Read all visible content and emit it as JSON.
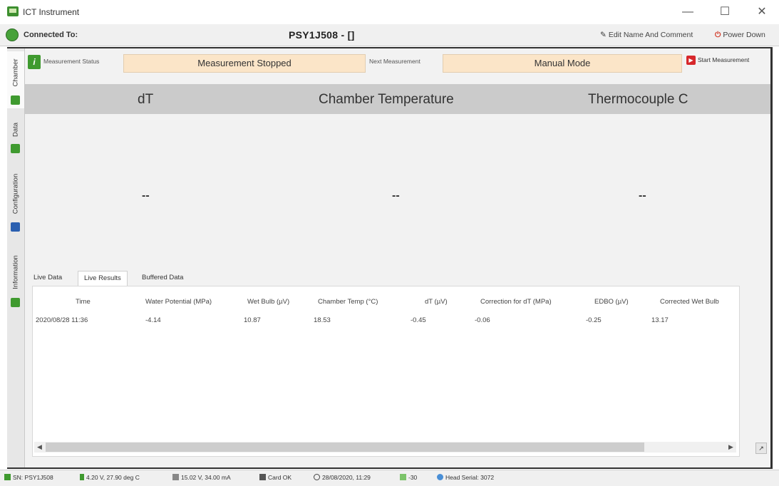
{
  "window": {
    "title": "ICT Instrument",
    "minimize_label": "—",
    "maximize_label": "☐",
    "close_label": "✕"
  },
  "connection": {
    "label": "Connected To:",
    "device_title": "PSY1J508 - []",
    "edit_label": "Edit Name And Comment",
    "power_label": "Power Down"
  },
  "side_tabs": [
    {
      "label": "Chamber",
      "icon": "chamber-icon",
      "color": "#3f9a2f"
    },
    {
      "label": "Data",
      "icon": "data-icon",
      "color": "#3f9a2f"
    },
    {
      "label": "Configuration",
      "icon": "configuration-icon",
      "color": "#2a5fb0"
    },
    {
      "label": "Information",
      "icon": "information-icon",
      "color": "#3f9a2f"
    }
  ],
  "status": {
    "measurement_status_label": "Measurement Status",
    "measurement_status_value": "Measurement Stopped",
    "next_measurement_label": "Next Measurement",
    "next_measurement_value": "Manual Mode",
    "start_button_label": "Start Measurement"
  },
  "readings": {
    "headers": [
      "dT",
      "Chamber Temperature",
      "Thermocouple C"
    ],
    "values": [
      "--",
      "--",
      "--"
    ]
  },
  "tabs": {
    "items": [
      "Live Data",
      "Live Results",
      "Buffered Data"
    ],
    "active": "Live Results"
  },
  "results_table": {
    "columns": [
      "Time",
      "Water Potential (MPa)",
      "Wet Bulb (µV)",
      "Chamber Temp (°C)",
      "dT (µV)",
      "Correction for dT (MPa)",
      "EDBO (µV)",
      "Corrected Wet Bulb"
    ],
    "rows": [
      [
        "2020/08/28 11:36",
        "-4.14",
        "10.87",
        "18.53",
        "-0.45",
        "-0.06",
        "-0.25",
        "13.17"
      ]
    ]
  },
  "statusbar": {
    "serial": "SN: PSY1J508",
    "battery": "4.20 V, 27.90 deg C",
    "power": "15.02 V, 34.00 mA",
    "card": "Card OK",
    "datetime": "28/08/2020, 11:29",
    "signal": "-30",
    "head_serial": "Head Serial: 3072"
  },
  "colors": {
    "field_bg": "#fbe5c8",
    "header_band": "#cbcbcb",
    "accent_green": "#3f9a2f",
    "accent_red": "#d7272b"
  }
}
